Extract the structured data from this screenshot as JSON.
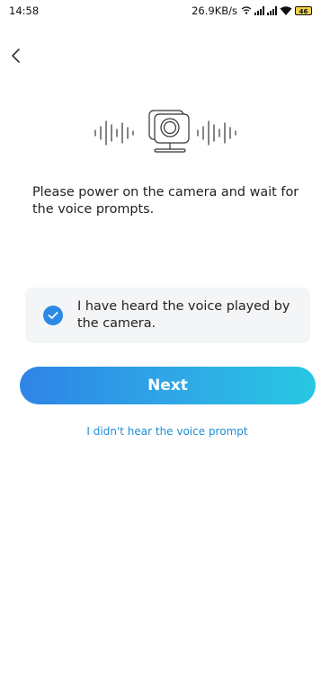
{
  "status_bar": {
    "time": "14:58",
    "speed": "26.9KB/s",
    "battery": "46"
  },
  "icons": {
    "back": "chevron-left-icon",
    "illustration": "camera-voice-icon",
    "check": "checkmark-icon"
  },
  "main": {
    "instruction": "Please power on the camera and wait for the voice prompts.",
    "confirm_text": "I have heard the voice played by the camera.",
    "next_label": "Next",
    "help_link": "I didn't hear the voice prompt"
  },
  "colors": {
    "accent": "#2b8ae6",
    "link": "#1f8fd6",
    "button_gradient_start": "#2e84e6",
    "button_gradient_end": "#27c7e3"
  }
}
